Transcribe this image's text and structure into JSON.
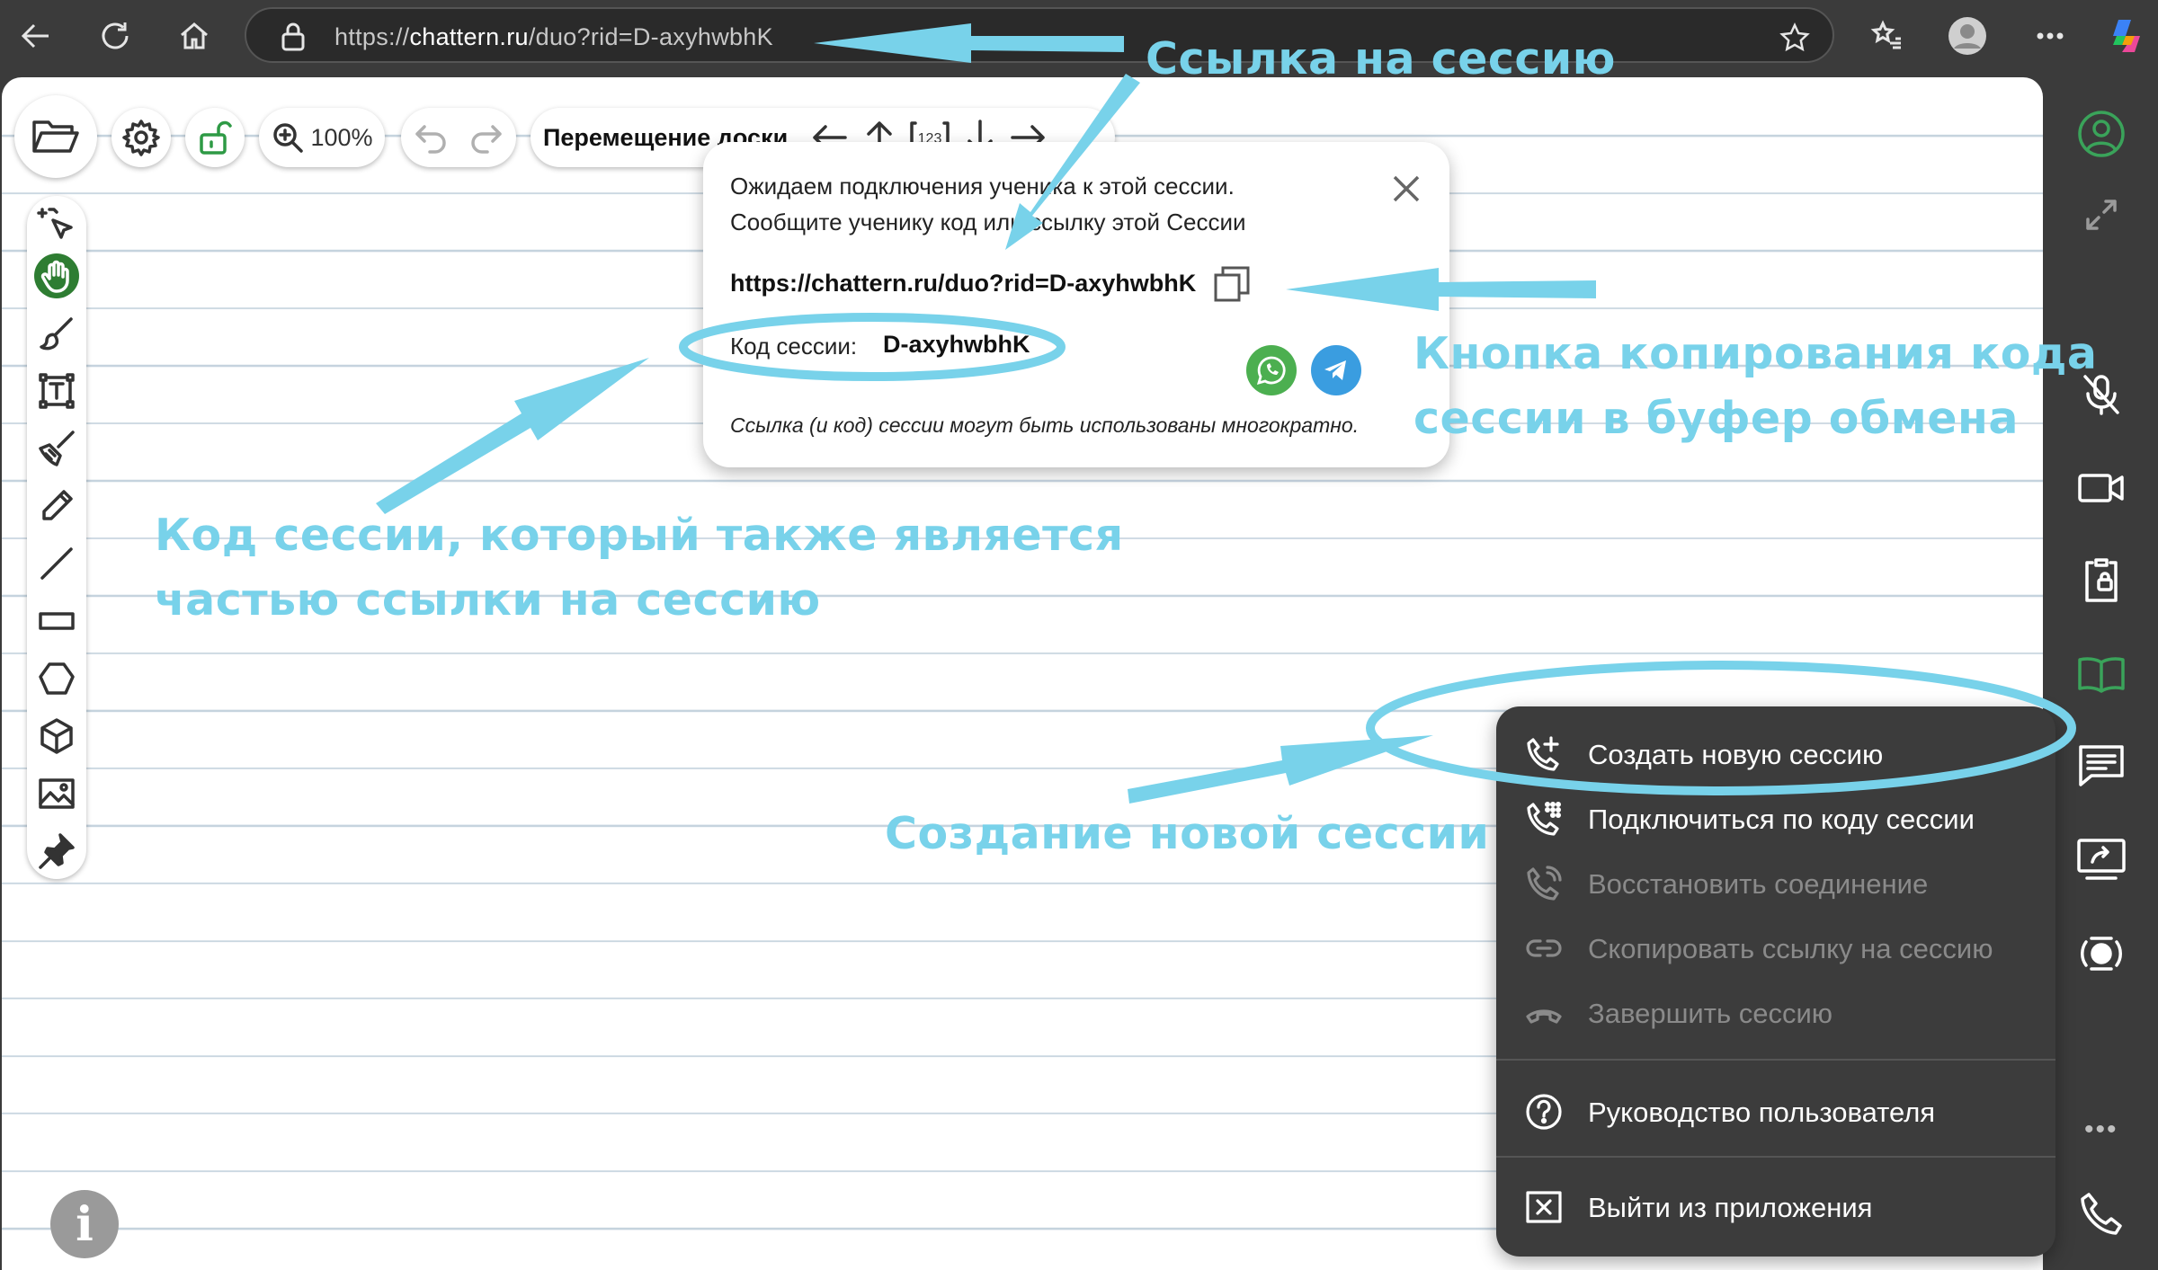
{
  "browser": {
    "url_prefix": "https://",
    "url_domain": "chattern.ru",
    "url_path": "/duo?rid=D-axyhwbhK"
  },
  "toolbar": {
    "zoom": "100%",
    "move_label": "Перемещение доски"
  },
  "popup": {
    "line1": "Ожидаем подключения ученика к этой сессии.",
    "line2": "Сообщите ученику код или ссылку этой Сессии",
    "link": "https://chattern.ru/duo?rid=D-axyhwbhK",
    "code_label": "Код сессии:",
    "code": "D-axyhwbhK",
    "note": "Ссылка (и код) сессии могут быть использованы многократно."
  },
  "menu": {
    "items": [
      {
        "label": "Создать новую сессию",
        "enabled": true
      },
      {
        "label": "Подключиться по коду сессии",
        "enabled": true
      },
      {
        "label": "Восстановить соединение",
        "enabled": false
      },
      {
        "label": "Скопировать ссылку на сессию",
        "enabled": false
      },
      {
        "label": "Завершить сессию",
        "enabled": false
      },
      {
        "label": "Руководство пользователя",
        "enabled": true
      },
      {
        "label": "Выйти из приложения",
        "enabled": true
      }
    ]
  },
  "info_button": "i",
  "annotations": {
    "session_link": "Ссылка на сессию",
    "copy_button_line1": "Кнопка копирования кода",
    "copy_button_line2": "сессии в буфер обмена",
    "code_line1": "Код сессии, который также является",
    "code_line2": "частью  ссылки на сессию",
    "new_session": "Создание новой сессии"
  },
  "colors": {
    "annotation": "#78d2ea",
    "active_tool": "#2e7d32",
    "whatsapp": "#4caf50",
    "telegram": "#3a9de0",
    "menu_bg": "#3c3c3c"
  }
}
